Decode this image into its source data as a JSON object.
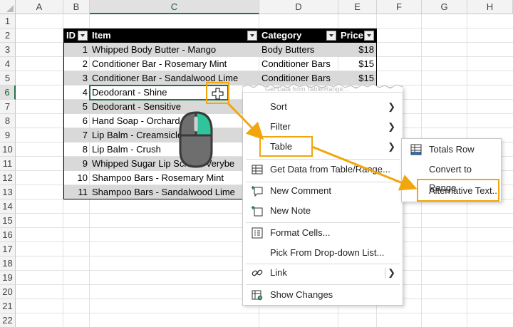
{
  "columns": [
    "A",
    "B",
    "C",
    "D",
    "E",
    "F",
    "G",
    "H"
  ],
  "rows": [
    "1",
    "2",
    "3",
    "4",
    "5",
    "6",
    "7",
    "8",
    "9",
    "10",
    "11",
    "12",
    "13",
    "14",
    "15",
    "16",
    "17",
    "18",
    "19",
    "20",
    "21",
    "22"
  ],
  "table": {
    "headers": [
      "ID",
      "Item",
      "Category",
      "Price"
    ],
    "rows": [
      {
        "id": "1",
        "item": "Whipped Body Butter - Mango",
        "category": "Body Butters",
        "price": "$18"
      },
      {
        "id": "2",
        "item": "Conditioner Bar - Rosemary Mint",
        "category": "Conditioner Bars",
        "price": "$15"
      },
      {
        "id": "3",
        "item": "Conditioner Bar - Sandalwood Lime",
        "category": "Conditioner Bars",
        "price": "$15"
      },
      {
        "id": "4",
        "item": "Deodorant - Shine",
        "category": "",
        "price": ""
      },
      {
        "id": "5",
        "item": "Deodorant - Sensitive",
        "category": "",
        "price": ""
      },
      {
        "id": "6",
        "item": "Hand Soap - Orchard",
        "category": "",
        "price": ""
      },
      {
        "id": "7",
        "item": "Lip Balm - Creamsicle",
        "category": "",
        "price": ""
      },
      {
        "id": "8",
        "item": "Lip Balm - Crush",
        "category": "",
        "price": ""
      },
      {
        "id": "9",
        "item": "Whipped Sugar Lip Scrub - Verybe",
        "category": "",
        "price": ""
      },
      {
        "id": "10",
        "item": "Shampoo Bars - Rosemary Mint",
        "category": "",
        "price": ""
      },
      {
        "id": "11",
        "item": "Shampoo Bars - Sandalwood Lime",
        "category": "",
        "price": ""
      }
    ]
  },
  "context_menu": {
    "torn_text": "Get Data from Table/Range...",
    "items": [
      {
        "label": "Sort",
        "icon": "",
        "submenu": true
      },
      {
        "label": "Filter",
        "icon": "",
        "submenu": true
      },
      {
        "label": "Table",
        "icon": "",
        "submenu": true
      },
      {
        "label": "Get Data from Table/Range...",
        "icon": "table-data-icon"
      },
      {
        "label": "New Comment",
        "icon": "new-comment-icon"
      },
      {
        "label": "New Note",
        "icon": "new-note-icon"
      },
      {
        "label": "Format Cells...",
        "icon": "format-cells-icon"
      },
      {
        "label": "Pick From Drop-down List...",
        "icon": ""
      },
      {
        "label": "Link",
        "icon": "link-icon",
        "submenu": true
      },
      {
        "label": "Show Changes",
        "icon": "show-changes-icon"
      }
    ]
  },
  "table_submenu": {
    "items": [
      {
        "label": "Totals Row",
        "icon": "totals-row-icon"
      },
      {
        "label": "Convert to Range",
        "icon": ""
      },
      {
        "label": "Alternative Text...",
        "icon": ""
      }
    ]
  },
  "colors": {
    "highlight": "#f2a60c",
    "excel_green": "#217346",
    "band": "#d9d9d9",
    "mouse_button": "#2fc49c"
  }
}
